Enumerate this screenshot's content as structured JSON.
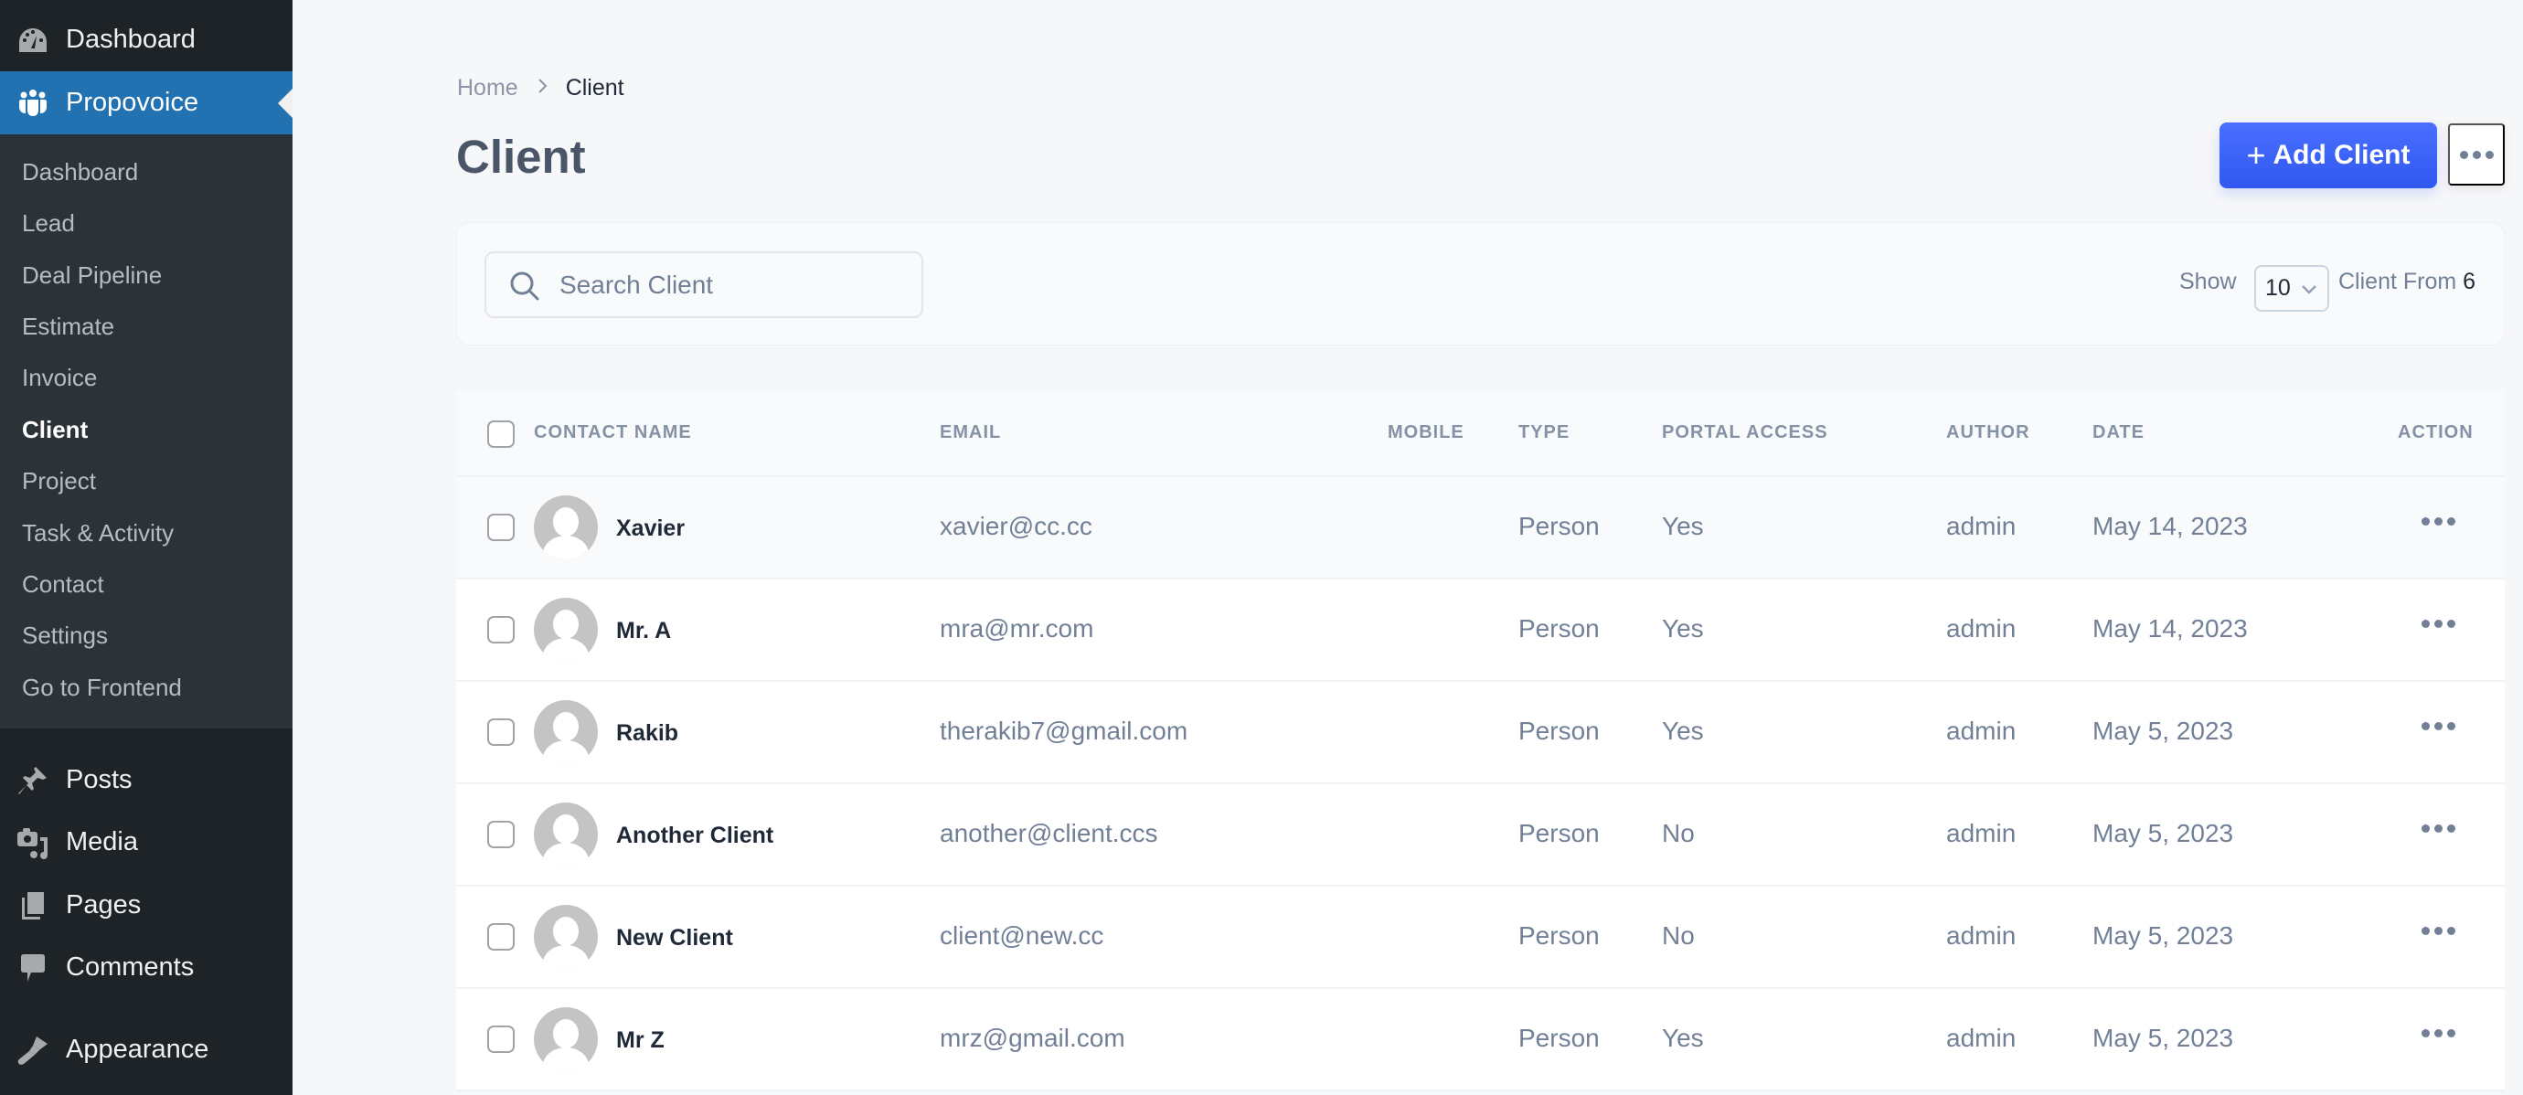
{
  "sidebar": {
    "top_items": [
      {
        "label": "Dashboard",
        "icon": "dashboard-icon"
      },
      {
        "label": "Propovoice",
        "icon": "users-group-icon",
        "active": true
      }
    ],
    "submenu": [
      {
        "label": "Dashboard"
      },
      {
        "label": "Lead"
      },
      {
        "label": "Deal Pipeline"
      },
      {
        "label": "Estimate"
      },
      {
        "label": "Invoice"
      },
      {
        "label": "Client",
        "current": true
      },
      {
        "label": "Project"
      },
      {
        "label": "Task & Activity"
      },
      {
        "label": "Contact"
      },
      {
        "label": "Settings"
      },
      {
        "label": "Go to Frontend"
      }
    ],
    "bottom_items": [
      {
        "label": "Posts",
        "icon": "pin-icon"
      },
      {
        "label": "Media",
        "icon": "media-icon"
      },
      {
        "label": "Pages",
        "icon": "pages-icon"
      },
      {
        "label": "Comments",
        "icon": "comment-icon"
      },
      {
        "label": "Appearance",
        "icon": "brush-icon"
      }
    ]
  },
  "breadcrumb": {
    "home": "Home",
    "separator": ">",
    "current": "Client"
  },
  "page_title": "Client",
  "toolbar": {
    "add_label": "Add Client",
    "add_icon": "+"
  },
  "filter": {
    "search_placeholder": "Search Client",
    "search_value": "",
    "show_label": "Show",
    "per_page": "10",
    "from_label": "Client From",
    "total": "6"
  },
  "table": {
    "columns": [
      "CONTACT NAME",
      "EMAIL",
      "MOBILE",
      "TYPE",
      "PORTAL ACCESS",
      "AUTHOR",
      "DATE",
      "ACTION"
    ],
    "rows": [
      {
        "name": "Xavier",
        "email": "xavier@cc.cc",
        "mobile": "",
        "type": "Person",
        "portal": "Yes",
        "author": "admin",
        "date": "May 14, 2023"
      },
      {
        "name": "Mr. A",
        "email": "mra@mr.com",
        "mobile": "",
        "type": "Person",
        "portal": "Yes",
        "author": "admin",
        "date": "May 14, 2023"
      },
      {
        "name": "Rakib",
        "email": "therakib7@gmail.com",
        "mobile": "",
        "type": "Person",
        "portal": "Yes",
        "author": "admin",
        "date": "May 5, 2023"
      },
      {
        "name": "Another Client",
        "email": "another@client.ccs",
        "mobile": "",
        "type": "Person",
        "portal": "No",
        "author": "admin",
        "date": "May 5, 2023"
      },
      {
        "name": "New Client",
        "email": "client@new.cc",
        "mobile": "",
        "type": "Person",
        "portal": "No",
        "author": "admin",
        "date": "May 5, 2023"
      },
      {
        "name": "Mr Z",
        "email": "mrz@gmail.com",
        "mobile": "",
        "type": "Person",
        "portal": "Yes",
        "author": "admin",
        "date": "May 5, 2023"
      }
    ]
  },
  "colors": {
    "sidebar_bg": "#1d2327",
    "submenu_bg": "#2c3338",
    "active_item": "#2271b1",
    "primary_button": "#3b63f7",
    "muted_text": "#718096",
    "title_text": "#4a5568"
  }
}
